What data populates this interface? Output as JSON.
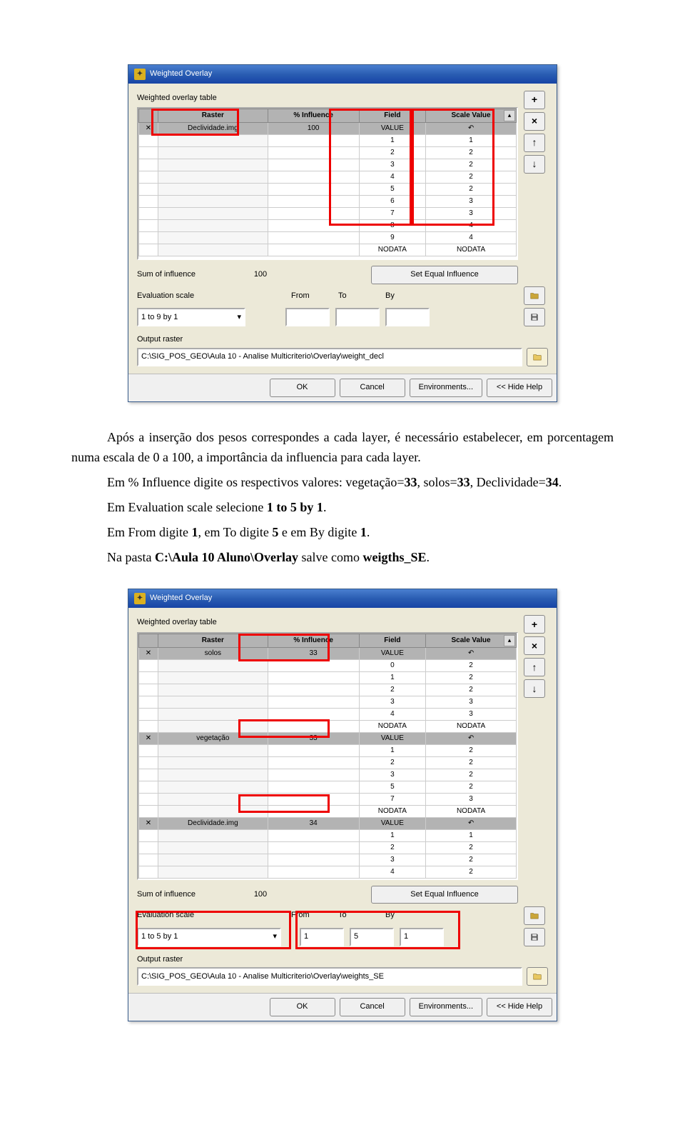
{
  "dialog_title": "Weighted Overlay",
  "group_label": "Weighted overlay table",
  "headers": {
    "raster": "Raster",
    "influence": "% Influence",
    "field": "Field",
    "scale": "Scale Value"
  },
  "d1": {
    "raster": "Declividade.img",
    "influence": "100",
    "rowhead_field": "VALUE",
    "rowhead_scale": "↶",
    "rows": [
      {
        "f": "1",
        "s": "1"
      },
      {
        "f": "2",
        "s": "2"
      },
      {
        "f": "3",
        "s": "2"
      },
      {
        "f": "4",
        "s": "2"
      },
      {
        "f": "5",
        "s": "2"
      },
      {
        "f": "6",
        "s": "3"
      },
      {
        "f": "7",
        "s": "3"
      },
      {
        "f": "8",
        "s": "4"
      },
      {
        "f": "9",
        "s": "4"
      },
      {
        "f": "NODATA",
        "s": "NODATA"
      }
    ],
    "sum_label": "Sum of influence",
    "sum_val": "100",
    "seteq": "Set Equal Influence",
    "eval_label": "Evaluation scale",
    "eval_val": "1   to   9   by   1",
    "from": "From",
    "to": "To",
    "by": "By",
    "from_v": "",
    "to_v": "",
    "by_v": "",
    "out_label": "Output raster",
    "out_val": "C:\\SIG_POS_GEO\\Aula 10 - Analise Multicriterio\\Overlay\\weight_decl"
  },
  "d2": {
    "sections": [
      {
        "raster": "solos",
        "influence": "33",
        "rowhead_field": "VALUE",
        "rowhead_scale": "↶",
        "rows": [
          {
            "f": "0",
            "s": "2"
          },
          {
            "f": "1",
            "s": "2"
          },
          {
            "f": "2",
            "s": "2"
          },
          {
            "f": "3",
            "s": "3"
          },
          {
            "f": "4",
            "s": "3"
          },
          {
            "f": "NODATA",
            "s": "NODATA"
          }
        ]
      },
      {
        "raster": "vegetação",
        "influence": "33",
        "rowhead_field": "VALUE",
        "rowhead_scale": "↶",
        "rows": [
          {
            "f": "1",
            "s": "2"
          },
          {
            "f": "2",
            "s": "2"
          },
          {
            "f": "3",
            "s": "2"
          },
          {
            "f": "5",
            "s": "2"
          },
          {
            "f": "7",
            "s": "3"
          },
          {
            "f": "NODATA",
            "s": "NODATA"
          }
        ]
      },
      {
        "raster": "Declividade.img",
        "influence": "34",
        "rowhead_field": "VALUE",
        "rowhead_scale": "↶",
        "rows": [
          {
            "f": "1",
            "s": "1"
          },
          {
            "f": "2",
            "s": "2"
          },
          {
            "f": "3",
            "s": "2"
          },
          {
            "f": "4",
            "s": "2"
          }
        ]
      }
    ],
    "sum_label": "Sum of influence",
    "sum_val": "100",
    "seteq": "Set Equal Influence",
    "eval_label": "Evaluation scale",
    "eval_val": "1   to   5   by   1",
    "from": "From",
    "to": "To",
    "by": "By",
    "from_v": "1",
    "to_v": "5",
    "by_v": "1",
    "out_label": "Output raster",
    "out_val": "C:\\SIG_POS_GEO\\Aula 10 - Analise Multicriterio\\Overlay\\weights_SE"
  },
  "btns": {
    "ok": "OK",
    "cancel": "Cancel",
    "env": "Environments...",
    "hide": "<< Hide Help"
  },
  "side": {
    "plus": "+",
    "times": "×",
    "up": "↑",
    "down": "↓",
    "open": "📂",
    "save": "💾"
  },
  "text": {
    "p1a": "Após a inserção dos pesos correspondes a cada layer, é necessário estabelecer, em porcentagem numa escala de 0 a 100, a importância da influencia para cada layer.",
    "p2a": "Em % Influence digite os respectivos valores: vegetação=",
    "p2b": "33",
    "p2c": ", solos=",
    "p2d": "33",
    "p2e": ", Declividade=",
    "p2f": "34",
    "p2g": ".",
    "p3a": "Em Evaluation scale selecione ",
    "p3b": "1 to 5 by 1",
    "p3c": ".",
    "p4a": "Em From digite ",
    "p4b": "1",
    "p4c": ", em To digite ",
    "p4d": "5",
    "p4e": " e em By digite ",
    "p4f": "1",
    "p4g": ".",
    "p5a": "Na pasta ",
    "p5b": "C:\\Aula 10 Aluno\\Overlay",
    "p5c": " salve como ",
    "p5d": "weigths_SE",
    "p5e": "."
  }
}
